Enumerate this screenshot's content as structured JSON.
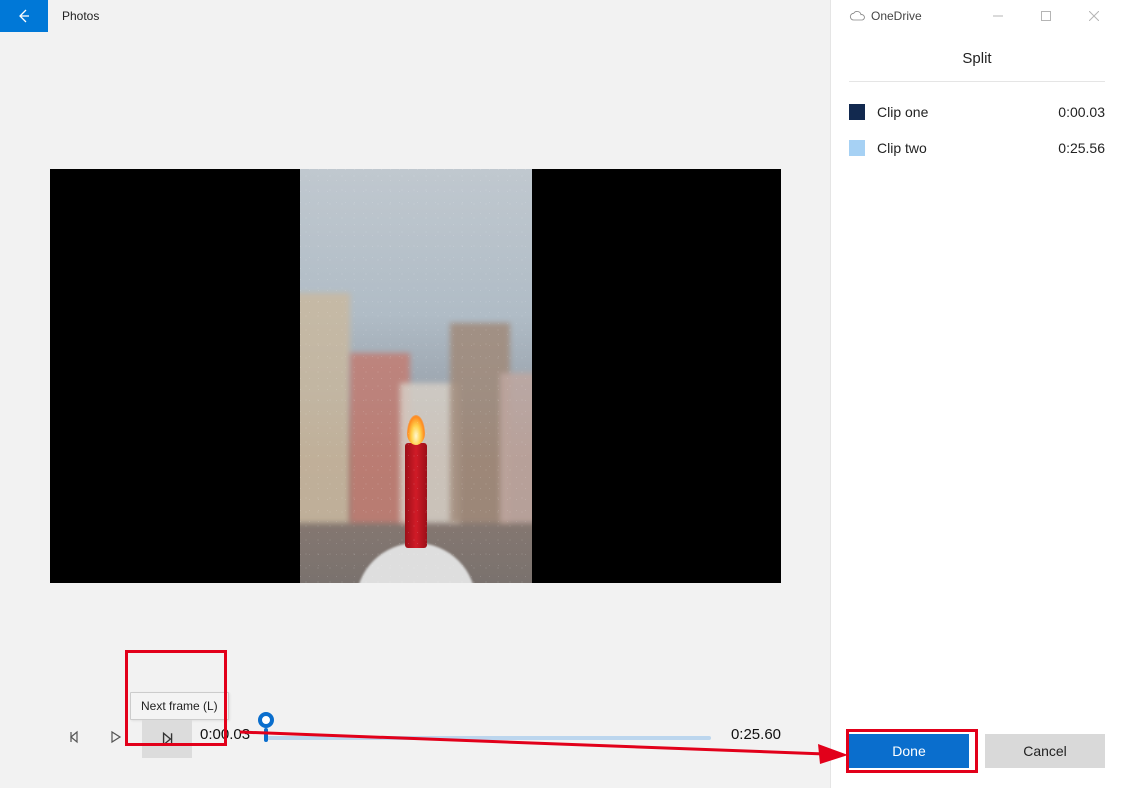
{
  "app": {
    "title": "Photos"
  },
  "tray": {
    "onedrive_label": "OneDrive"
  },
  "panel": {
    "title": "Split",
    "clips": [
      {
        "name": "Clip one",
        "time": "0:00.03",
        "color": "#12294f"
      },
      {
        "name": "Clip two",
        "time": "0:25.56",
        "color": "#a6d1f4"
      }
    ],
    "done_label": "Done",
    "cancel_label": "Cancel"
  },
  "playback": {
    "tooltip": "Next frame (L)",
    "current_time": "0:00.03",
    "end_time": "0:25.60"
  },
  "icons": {
    "back": "back-arrow",
    "prev_frame": "prev-frame",
    "play": "play",
    "next_frame": "next-frame",
    "onedrive": "cloud"
  }
}
